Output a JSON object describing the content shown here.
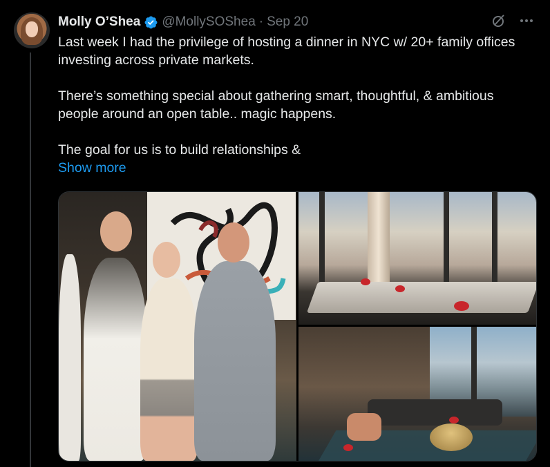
{
  "author": {
    "name": "Molly O’Shea",
    "handle": "@MollySOShea",
    "separator": "·",
    "date": "Sep 20",
    "verified": true,
    "avatar": "profile-photo"
  },
  "icons": {
    "verified": "verified-badge-icon",
    "grok": "grok-icon",
    "more": "more-options-icon"
  },
  "tweet": {
    "paragraphs": [
      "Last week I had the privilege of hosting a dinner in NYC w/ 20+ family offices investing across private markets.",
      "There’s something special about gathering smart, thoughtful, & ambitious people around an open table.. magic happens.",
      "The goal for us is to build relationships &"
    ],
    "show_more": "Show more"
  },
  "media": {
    "photos": [
      {
        "subject": "group-photo-four-people"
      },
      {
        "subject": "dining-room-city-view"
      },
      {
        "subject": "lounge-with-skyline"
      }
    ]
  },
  "colors": {
    "background": "#000000",
    "text": "#e7e9ea",
    "muted": "#71767b",
    "link": "#1d9bf0",
    "verified": "#1d9bf0",
    "border": "#2f3336"
  }
}
